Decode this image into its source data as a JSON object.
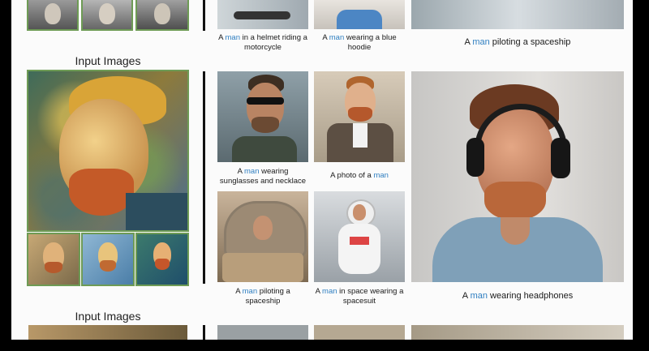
{
  "sections": {
    "input_title_1": "Input Images",
    "input_title_2": "Input Images"
  },
  "captions": {
    "top": [
      {
        "pre": "A ",
        "kw": "man",
        "post": " in a helmet riding a motorcycle"
      },
      {
        "pre": "A ",
        "kw": "man",
        "post": " wearing a blue hoodie"
      },
      {
        "pre": "A ",
        "kw": "man",
        "post": " piloting a spaceship"
      }
    ],
    "grid": [
      {
        "pre": "A ",
        "kw": "man",
        "post": " wearing sunglasses and necklace"
      },
      {
        "pre": "A photo of a ",
        "kw": "man",
        "post": ""
      },
      {
        "pre": "A ",
        "kw": "man",
        "post": " piloting a spaceship"
      },
      {
        "pre": "A ",
        "kw": "man",
        "post": " in space wearing a spacesuit"
      }
    ],
    "large": {
      "pre": "A ",
      "kw": "man",
      "post": " wearing headphones"
    }
  },
  "colors": {
    "keyword": "#2f7fc1",
    "frame": "#6e9b55",
    "background": "#fbfbfb"
  }
}
